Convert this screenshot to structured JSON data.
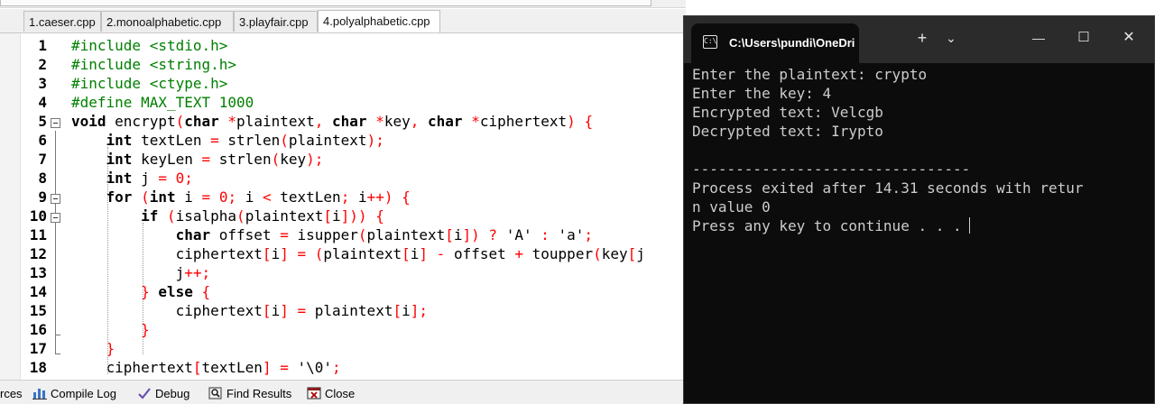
{
  "ide": {
    "tabs": [
      {
        "label": "1.caeser.cpp",
        "active": false
      },
      {
        "label": "2.monoalphabetic.cpp",
        "active": false
      },
      {
        "label": "3.playfair.cpp",
        "active": false
      },
      {
        "label": "4.polyalphabetic.cpp",
        "active": true
      }
    ],
    "code_lines": [
      {
        "num": "1",
        "segs": [
          [
            "pp",
            "#include <stdio.h>"
          ]
        ]
      },
      {
        "num": "2",
        "segs": [
          [
            "pp",
            "#include <string.h>"
          ]
        ]
      },
      {
        "num": "3",
        "segs": [
          [
            "pp",
            "#include <ctype.h>"
          ]
        ]
      },
      {
        "num": "4",
        "segs": [
          [
            "pp",
            "#define MAX_TEXT 1000"
          ]
        ]
      },
      {
        "num": "5",
        "segs": [
          [
            "kw",
            "void"
          ],
          [
            "st",
            " encrypt"
          ],
          [
            "op",
            "("
          ],
          [
            "kw",
            "char"
          ],
          [
            "st",
            " "
          ],
          [
            "op",
            "*"
          ],
          [
            "st",
            "plaintext"
          ],
          [
            "op",
            ","
          ],
          [
            "st",
            " "
          ],
          [
            "kw",
            "char"
          ],
          [
            "st",
            " "
          ],
          [
            "op",
            "*"
          ],
          [
            "st",
            "key"
          ],
          [
            "op",
            ","
          ],
          [
            "st",
            " "
          ],
          [
            "kw",
            "char"
          ],
          [
            "st",
            " "
          ],
          [
            "op",
            "*"
          ],
          [
            "st",
            "ciphertext"
          ],
          [
            "op",
            ")"
          ],
          [
            "st",
            " "
          ],
          [
            "op",
            "{"
          ]
        ]
      },
      {
        "num": "6",
        "segs": [
          [
            "st",
            "    "
          ],
          [
            "kw",
            "int"
          ],
          [
            "st",
            " textLen "
          ],
          [
            "op",
            "="
          ],
          [
            "st",
            " strlen"
          ],
          [
            "op",
            "("
          ],
          [
            "st",
            "plaintext"
          ],
          [
            "op",
            ");"
          ]
        ]
      },
      {
        "num": "7",
        "segs": [
          [
            "st",
            "    "
          ],
          [
            "kw",
            "int"
          ],
          [
            "st",
            " keyLen "
          ],
          [
            "op",
            "="
          ],
          [
            "st",
            " strlen"
          ],
          [
            "op",
            "("
          ],
          [
            "st",
            "key"
          ],
          [
            "op",
            ");"
          ]
        ]
      },
      {
        "num": "8",
        "segs": [
          [
            "st",
            "    "
          ],
          [
            "kw",
            "int"
          ],
          [
            "st",
            " j "
          ],
          [
            "op",
            "="
          ],
          [
            "st",
            " "
          ],
          [
            "op",
            "0;"
          ]
        ]
      },
      {
        "num": "9",
        "segs": [
          [
            "st",
            "    "
          ],
          [
            "kw",
            "for"
          ],
          [
            "st",
            " "
          ],
          [
            "op",
            "("
          ],
          [
            "kw",
            "int"
          ],
          [
            "st",
            " i "
          ],
          [
            "op",
            "="
          ],
          [
            "st",
            " "
          ],
          [
            "op",
            "0;"
          ],
          [
            "st",
            " i "
          ],
          [
            "op",
            "<"
          ],
          [
            "st",
            " textLen"
          ],
          [
            "op",
            ";"
          ],
          [
            "st",
            " i"
          ],
          [
            "op",
            "++)"
          ],
          [
            "st",
            " "
          ],
          [
            "op",
            "{"
          ]
        ]
      },
      {
        "num": "10",
        "segs": [
          [
            "st",
            "        "
          ],
          [
            "kw",
            "if"
          ],
          [
            "st",
            " "
          ],
          [
            "op",
            "("
          ],
          [
            "st",
            "isalpha"
          ],
          [
            "op",
            "("
          ],
          [
            "st",
            "plaintext"
          ],
          [
            "op",
            "["
          ],
          [
            "st",
            "i"
          ],
          [
            "op",
            "]))"
          ],
          [
            "st",
            " "
          ],
          [
            "op",
            "{"
          ]
        ]
      },
      {
        "num": "11",
        "segs": [
          [
            "st",
            "            "
          ],
          [
            "kw",
            "char"
          ],
          [
            "st",
            " offset "
          ],
          [
            "op",
            "="
          ],
          [
            "st",
            " isupper"
          ],
          [
            "op",
            "("
          ],
          [
            "st",
            "plaintext"
          ],
          [
            "op",
            "["
          ],
          [
            "st",
            "i"
          ],
          [
            "op",
            "])"
          ],
          [
            "st",
            " "
          ],
          [
            "op",
            "?"
          ],
          [
            "st",
            " 'A' "
          ],
          [
            "op",
            ":"
          ],
          [
            "st",
            " 'a'"
          ],
          [
            "op",
            ";"
          ]
        ]
      },
      {
        "num": "12",
        "segs": [
          [
            "st",
            "            ciphertext"
          ],
          [
            "op",
            "["
          ],
          [
            "st",
            "i"
          ],
          [
            "op",
            "]"
          ],
          [
            "st",
            " "
          ],
          [
            "op",
            "="
          ],
          [
            "st",
            " "
          ],
          [
            "op",
            "("
          ],
          [
            "st",
            "plaintext"
          ],
          [
            "op",
            "["
          ],
          [
            "st",
            "i"
          ],
          [
            "op",
            "]"
          ],
          [
            "st",
            " "
          ],
          [
            "op",
            "-"
          ],
          [
            "st",
            " offset "
          ],
          [
            "op",
            "+"
          ],
          [
            "st",
            " toupper"
          ],
          [
            "op",
            "("
          ],
          [
            "st",
            "key"
          ],
          [
            "op",
            "["
          ],
          [
            "st",
            "j"
          ]
        ]
      },
      {
        "num": "13",
        "segs": [
          [
            "st",
            "            j"
          ],
          [
            "op",
            "++;"
          ]
        ]
      },
      {
        "num": "14",
        "segs": [
          [
            "st",
            "        "
          ],
          [
            "op",
            "}"
          ],
          [
            "st",
            " "
          ],
          [
            "kw",
            "else"
          ],
          [
            "st",
            " "
          ],
          [
            "op",
            "{"
          ]
        ]
      },
      {
        "num": "15",
        "segs": [
          [
            "st",
            "            ciphertext"
          ],
          [
            "op",
            "["
          ],
          [
            "st",
            "i"
          ],
          [
            "op",
            "]"
          ],
          [
            "st",
            " "
          ],
          [
            "op",
            "="
          ],
          [
            "st",
            " plaintext"
          ],
          [
            "op",
            "["
          ],
          [
            "st",
            "i"
          ],
          [
            "op",
            "];"
          ]
        ]
      },
      {
        "num": "16",
        "segs": [
          [
            "st",
            "        "
          ],
          [
            "op",
            "}"
          ]
        ]
      },
      {
        "num": "17",
        "segs": [
          [
            "st",
            "    "
          ],
          [
            "op",
            "}"
          ]
        ]
      },
      {
        "num": "18",
        "segs": [
          [
            "st",
            "    ciphertext"
          ],
          [
            "op",
            "["
          ],
          [
            "st",
            "textLen"
          ],
          [
            "op",
            "]"
          ],
          [
            "st",
            " "
          ],
          [
            "op",
            "="
          ],
          [
            "st",
            " '\\0'"
          ],
          [
            "op",
            ";"
          ]
        ]
      }
    ],
    "status_tabs": [
      {
        "label": "rces",
        "icon": "resources-icon"
      },
      {
        "label": "Compile Log",
        "icon": "bar-chart-icon"
      },
      {
        "label": "Debug",
        "icon": "checkmark-icon"
      },
      {
        "label": "Find Results",
        "icon": "magnifier-icon"
      },
      {
        "label": "Close",
        "icon": "close-window-icon"
      }
    ]
  },
  "terminal": {
    "title": "C:\\Users\\pundi\\OneDri",
    "new_tab_glyph": "+",
    "dropdown_glyph": "⌄",
    "minimize_glyph": "—",
    "maximize_glyph": "☐",
    "close_glyph": "✕",
    "lines": [
      "Enter the plaintext: crypto",
      "Enter the key: 4",
      "Encrypted text: Velcgb",
      "Decrypted text: Irypto",
      "",
      "--------------------------------",
      "Process exited after 14.31 seconds with retur",
      "n value 0",
      "Press any key to continue . . ."
    ]
  }
}
